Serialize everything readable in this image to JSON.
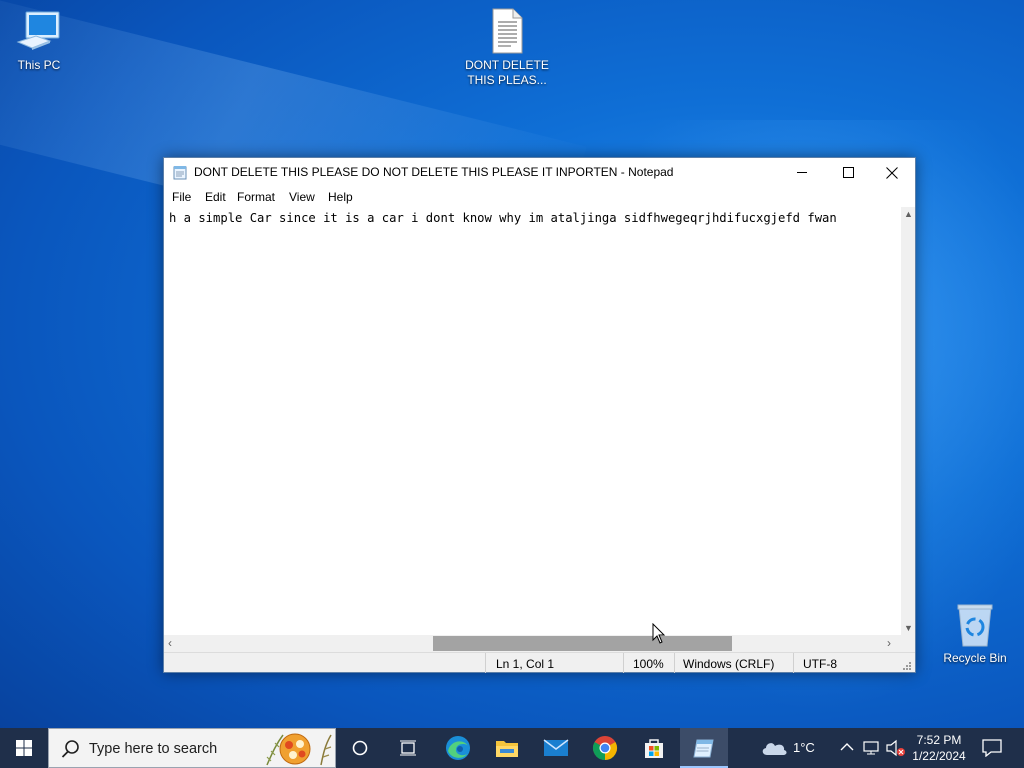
{
  "desktop": {
    "icons": [
      {
        "label": "This PC",
        "icon": "computer-icon"
      },
      {
        "label_line1": "DONT DELETE",
        "label_line2": "THIS PLEAS...",
        "icon": "text-document-icon"
      },
      {
        "label": "Recycle Bin",
        "icon": "recycle-bin-icon"
      }
    ]
  },
  "notepad": {
    "title": "DONT DELETE THIS PLEASE DO NOT DELETE THIS PLEASE IT INPORTEN - Notepad",
    "menu": [
      "File",
      "Edit",
      "Format",
      "View",
      "Help"
    ],
    "content": "h a simple Car since it is a car i dont know why im ataljinga sidfhwegeqrjhdifucxgjefd fwan",
    "status": {
      "position": "Ln 1, Col 1",
      "zoom": "100%",
      "line_ending": "Windows (CRLF)",
      "encoding": "UTF-8"
    }
  },
  "taskbar": {
    "search_placeholder": "Type here to search",
    "apps": [
      "cortana-icon",
      "task-view-icon",
      "edge-icon",
      "file-explorer-icon",
      "mail-icon",
      "chrome-icon",
      "store-icon",
      "notepad-icon"
    ],
    "weather": "1°C",
    "time": "7:52 PM",
    "date": "1/22/2024"
  },
  "colors": {
    "taskbar": "#1f2f4a",
    "desktop": "#0f6fd6",
    "accent": "#9cc7ff"
  }
}
